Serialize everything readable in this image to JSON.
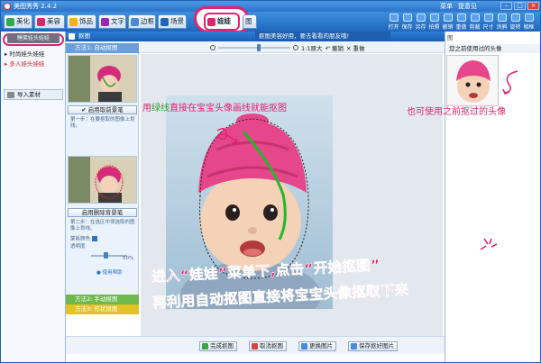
{
  "window": {
    "title": "美图秀秀 2.4.2",
    "menu": [
      "菜单",
      "提意见"
    ]
  },
  "tabs": [
    {
      "label": "美化",
      "color": "#34a853"
    },
    {
      "label": "美容",
      "color": "#e0236d"
    },
    {
      "label": "饰品",
      "color": "#f4b400"
    },
    {
      "label": "文字",
      "color": "#9c27b0"
    },
    {
      "label": "边框",
      "color": "#4a89dc"
    },
    {
      "label": "场景",
      "color": "#1f66bb"
    },
    {
      "label": "娃娃",
      "color": "#e0236d",
      "selected": true
    },
    {
      "label": "图",
      "color": "#4a89dc"
    }
  ],
  "tools": [
    "打开",
    "保存",
    "另存",
    "拍照",
    "撤销",
    "重做",
    "剪裁",
    "尺寸",
    "涂鸦",
    "旋转",
    "相框"
  ],
  "left_panel": {
    "item1": "随机娃娃",
    "header": "睡笑娃头娃娃",
    "item2": "时尚娃头娃娃",
    "item3": "多人娃头娃娃",
    "import_label": "导入素材"
  },
  "dialog": {
    "title": "抠图",
    "selection_title": "抠图美容好用，要去看看的朋友哦!",
    "zoom_label": "1:1原大",
    "undo_label": "撤销",
    "redo_label": "重做",
    "step1": {
      "title": "方法1: 自动抠图",
      "button": "启用取前景笔",
      "desc": "第一步：在要抠取的图像上划线。"
    },
    "step2_inner": {
      "button": "启用删除背景笔",
      "desc": "第二步：在选区中误选取的图像上划线。",
      "bg_color_label": "蒙板颜色",
      "opacity_label": "透明度",
      "opacity_value": "50%",
      "help_label": "使用帮助"
    },
    "method2": "方法2: 手动抠图",
    "method3": "方法3: 形状抠图"
  },
  "bottom_buttons": [
    "完成抠图",
    "取消抠图",
    "更换图片",
    "保存抠好图片"
  ],
  "right_panel": {
    "label": "您之前使用过的头像",
    "top_text": "图"
  },
  "annotations": {
    "green_hint_prefix": "用",
    "green_hint_green": "绿线",
    "green_hint_suffix": "直接在宝宝头像画线就能抠图",
    "reuse_hint": "也可使用之前抠过的头像",
    "instruction_line1": "进入“娃娃”菜单下,点击“开始抠图”",
    "instruction_line2": "再利用自动抠图直接将宝宝头像抠取下来"
  },
  "colors": {
    "accent": "#e0236d",
    "green": "#26a32b",
    "titlebar": "#2a73c9"
  }
}
